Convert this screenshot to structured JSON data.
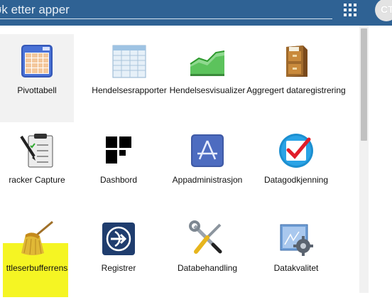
{
  "search": {
    "placeholder": "øk etter apper",
    "value": ""
  },
  "topbar": {
    "apps_icon": "grid-icon",
    "avatar_initials": "CT"
  },
  "apps": [
    {
      "label": "Pivottabell",
      "icon": "pivot-table-icon",
      "selected": true
    },
    {
      "label": "Hendelsesrapporter",
      "icon": "event-reports-icon",
      "selected": false
    },
    {
      "label": "Hendelsesvisualizer",
      "icon": "event-visualizer-icon",
      "selected": false
    },
    {
      "label": "Aggregert dataregistrering",
      "icon": "cabinet-icon",
      "selected": false
    },
    {
      "label": "racker Capture",
      "icon": "clipboard-icon",
      "selected": false
    },
    {
      "label": "Dashbord",
      "icon": "dashboard-icon",
      "selected": false
    },
    {
      "label": "Appadministrasjon",
      "icon": "app-store-icon",
      "selected": false
    },
    {
      "label": "Datagodkjenning",
      "icon": "approval-icon",
      "selected": false
    },
    {
      "label": "ttleserbufferrens",
      "icon": "broom-icon",
      "selected": false
    },
    {
      "label": "Registrer",
      "icon": "register-icon",
      "selected": false
    },
    {
      "label": "Databehandling",
      "icon": "tools-icon",
      "selected": false
    },
    {
      "label": "Datakvalitet",
      "icon": "data-quality-icon",
      "selected": false
    }
  ],
  "colors": {
    "header": "#2f6294",
    "highlight": "#f5f523",
    "selected_tile": "#f2f2f2"
  }
}
